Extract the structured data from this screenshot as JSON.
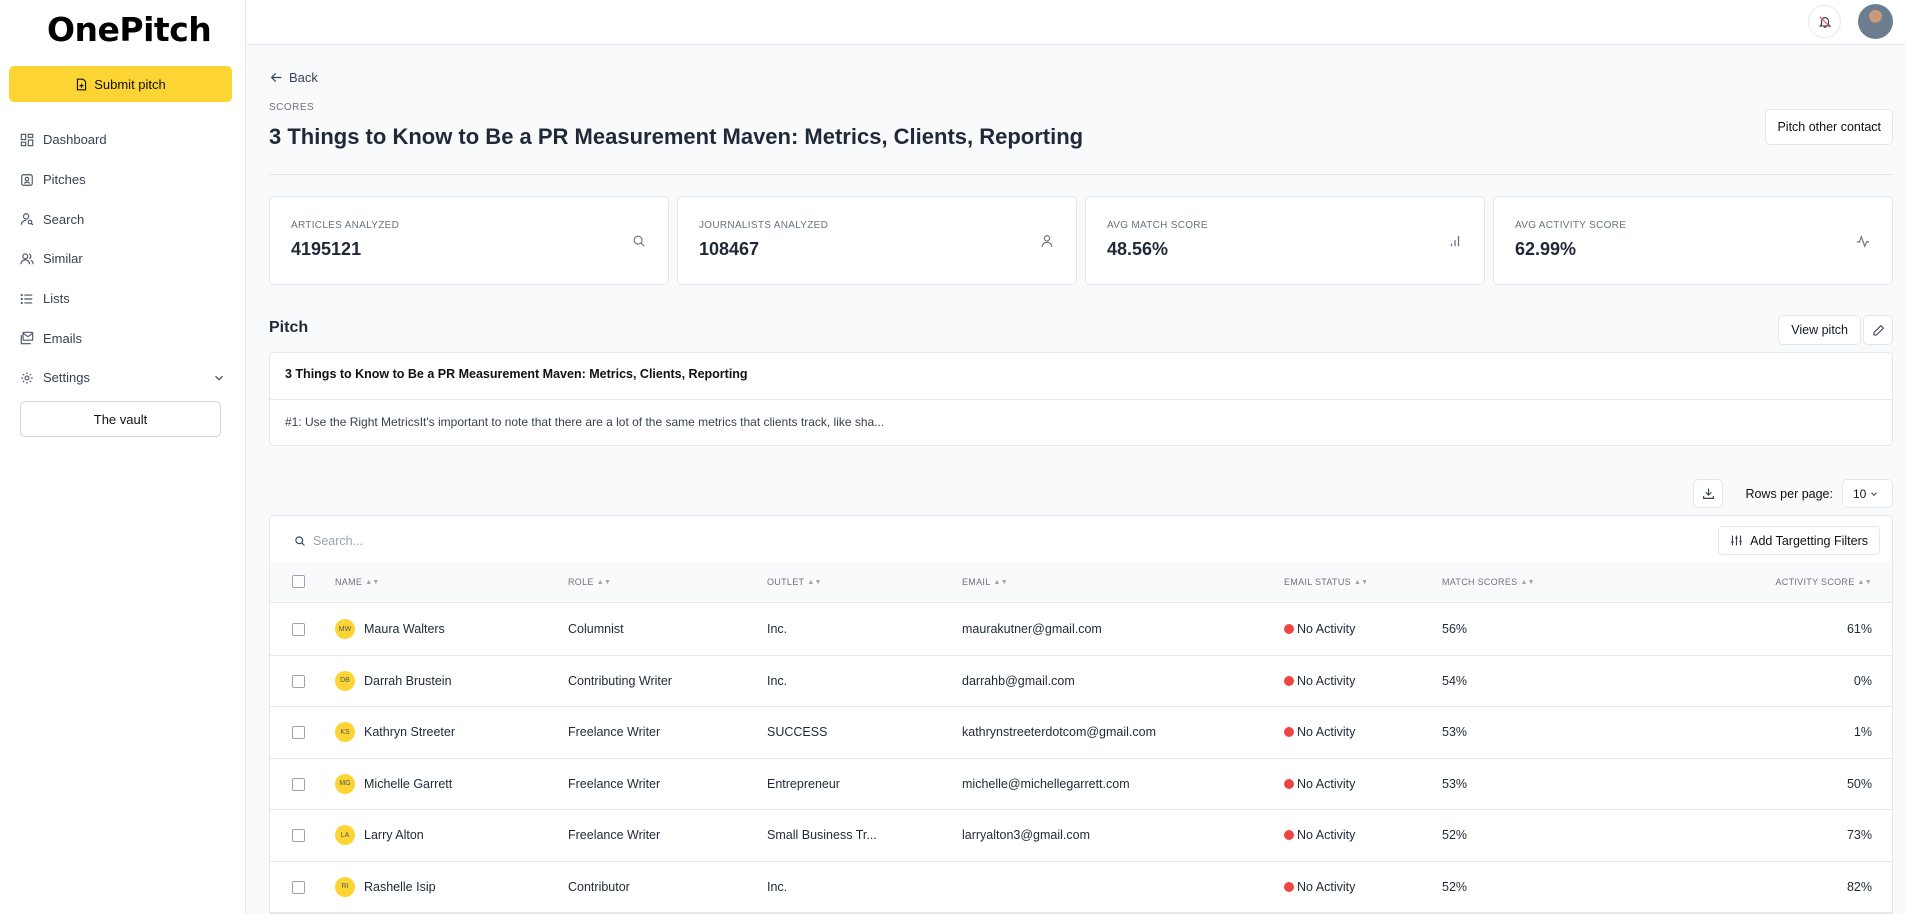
{
  "app": {
    "logo": "OnePitch",
    "submit_label": "Submit pitch",
    "vault_label": "The vault"
  },
  "nav": [
    {
      "label": "Dashboard",
      "icon": "dashboard-icon"
    },
    {
      "label": "Pitches",
      "icon": "pitches-icon"
    },
    {
      "label": "Search",
      "icon": "search-person-icon"
    },
    {
      "label": "Similar",
      "icon": "users-icon"
    },
    {
      "label": "Lists",
      "icon": "list-icon"
    },
    {
      "label": "Emails",
      "icon": "emails-icon"
    },
    {
      "label": "Settings",
      "icon": "gear-icon"
    }
  ],
  "header": {
    "back": "Back",
    "eyebrow": "SCORES",
    "title": "3 Things to Know to Be a PR Measurement Maven: Metrics, Clients, Reporting",
    "pitch_other": "Pitch other contact"
  },
  "stats": [
    {
      "label": "ARTICLES ANALYZED",
      "value": "4195121",
      "icon": "search-icon"
    },
    {
      "label": "JOURNALISTS ANALYZED",
      "value": "108467",
      "icon": "user-icon"
    },
    {
      "label": "AVG MATCH SCORE",
      "value": "48.56%",
      "icon": "bar-chart-icon"
    },
    {
      "label": "AVG ACTIVITY SCORE",
      "value": "62.99%",
      "icon": "activity-icon"
    }
  ],
  "pitch": {
    "heading": "Pitch",
    "view_label": "View pitch",
    "title": "3 Things to Know to Be a PR Measurement Maven: Metrics, Clients, Reporting",
    "body": "#1: Use the Right MetricsIt's important to note that there are a lot of the same metrics that clients track, like sha..."
  },
  "toolbar": {
    "rows_label": "Rows per page:",
    "rows_value": "10"
  },
  "table": {
    "search_placeholder": "Search...",
    "filters_label": "Add Targetting Filters",
    "headers": {
      "name": "NAME",
      "role": "ROLE",
      "outlet": "OUTLET",
      "email": "EMAIL",
      "email_status": "EMAIL STATUS",
      "match": "MATCH SCORES",
      "activity": "ACTIVITY SCORE"
    },
    "rows": [
      {
        "initials": "MW",
        "name": "Maura Walters",
        "role": "Columnist",
        "outlet": "Inc.",
        "email": "maurakutner@gmail.com",
        "status": "No Activity",
        "match": "56%",
        "activity": "61%"
      },
      {
        "initials": "DB",
        "name": "Darrah Brustein",
        "role": "Contributing Writer",
        "outlet": "Inc.",
        "email": "darrahb@gmail.com",
        "status": "No Activity",
        "match": "54%",
        "activity": "0%"
      },
      {
        "initials": "KS",
        "name": "Kathryn Streeter",
        "role": "Freelance Writer",
        "outlet": "SUCCESS",
        "email": "kathrynstreeterdotcom@gmail.com",
        "status": "No Activity",
        "match": "53%",
        "activity": "1%"
      },
      {
        "initials": "MG",
        "name": "Michelle Garrett",
        "role": "Freelance Writer",
        "outlet": "Entrepreneur",
        "email": "michelle@michellegarrett.com",
        "status": "No Activity",
        "match": "53%",
        "activity": "50%"
      },
      {
        "initials": "LA",
        "name": "Larry Alton",
        "role": "Freelance Writer",
        "outlet": "Small Business Tr...",
        "email": "larryalton3@gmail.com",
        "status": "No Activity",
        "match": "52%",
        "activity": "73%"
      },
      {
        "initials": "RI",
        "name": "Rashelle Isip",
        "role": "Contributor",
        "outlet": "Inc.",
        "email": "",
        "status": "No Activity",
        "match": "52%",
        "activity": "82%"
      }
    ]
  },
  "colors": {
    "accent": "#fcd535",
    "status_red": "#ef4444"
  }
}
